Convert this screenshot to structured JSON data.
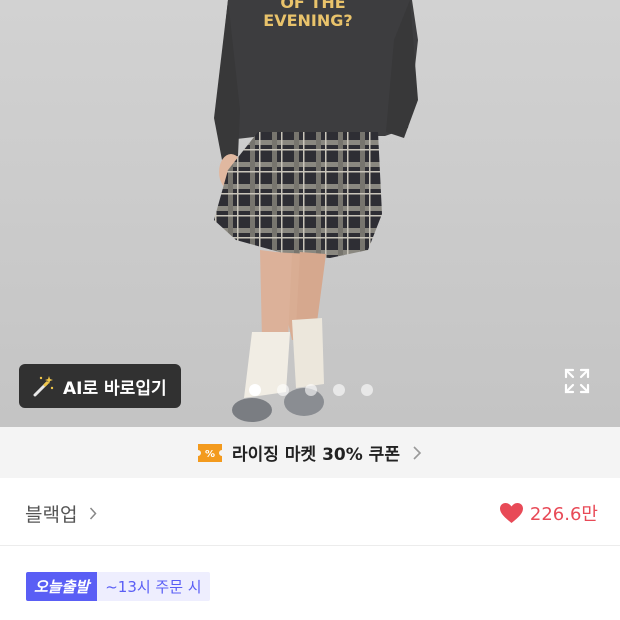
{
  "hero": {
    "shirt_text_line1": "OF THE",
    "shirt_text_line2": "EVENING?",
    "ai_button_label": "AI로 바로입기",
    "carousel_total": 5,
    "carousel_active": 1
  },
  "coupon": {
    "label": "라이징 마켓 30% 쿠폰",
    "icon": "coupon-percent-icon"
  },
  "brand": {
    "name": "블랙업"
  },
  "likes": {
    "count": "226.6만",
    "color": "#e84a57"
  },
  "shipping": {
    "badge": "오늘출발",
    "cutoff": "~13시 주문 시",
    "badge_color": "#5a5ef5"
  },
  "product": {
    "title_partial": ""
  }
}
